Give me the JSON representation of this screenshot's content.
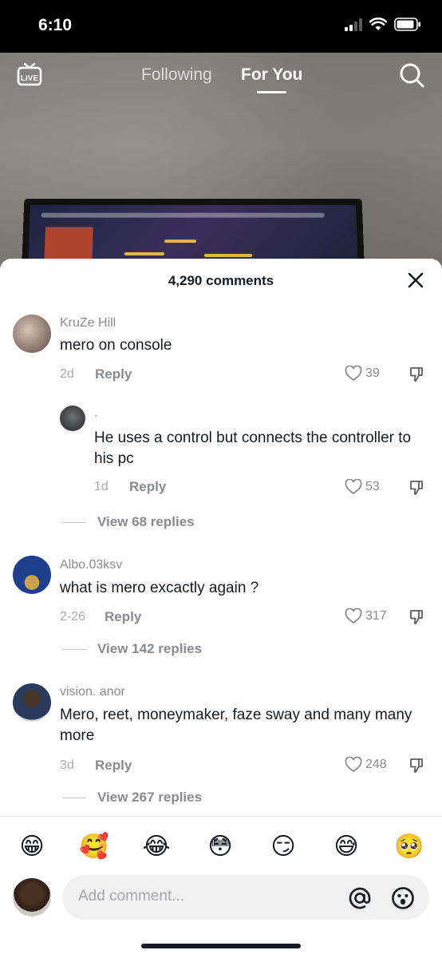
{
  "status_bar": {
    "time": "6:10"
  },
  "top_nav": {
    "tabs": [
      {
        "label": "Following",
        "active": false
      },
      {
        "label": "For You",
        "active": true
      }
    ],
    "live_label": "LIVE"
  },
  "comments_panel": {
    "title": "4,290 comments",
    "comments": [
      {
        "user": "KruZe Hill",
        "text": "mero on console",
        "date": "2d",
        "reply_label": "Reply",
        "likes": "39"
      },
      {
        "user": ".",
        "text": "He uses a control but connects the controller to his pc",
        "date": "1d",
        "reply_label": "Reply",
        "likes": "53"
      },
      {
        "user": "Albo.03ksv",
        "text": "what is mero excactly again ?",
        "date": "2-26",
        "reply_label": "Reply",
        "likes": "317"
      },
      {
        "user": "vision. anor",
        "text": "Mero, reet, moneymaker, faze sway and many many more",
        "date": "3d",
        "reply_label": "Reply",
        "likes": "248"
      }
    ],
    "view_replies": [
      "View 68 replies",
      "View 142 replies",
      "View 267 replies"
    ]
  },
  "emoji_bar": [
    "😁",
    "🥰",
    "😂",
    "😳",
    "😏",
    "😅",
    "🥺"
  ],
  "input": {
    "placeholder": "Add comment..."
  },
  "colors": {
    "accent": "#161823",
    "muted": "#8a8b91",
    "panel": "#ffffff"
  }
}
